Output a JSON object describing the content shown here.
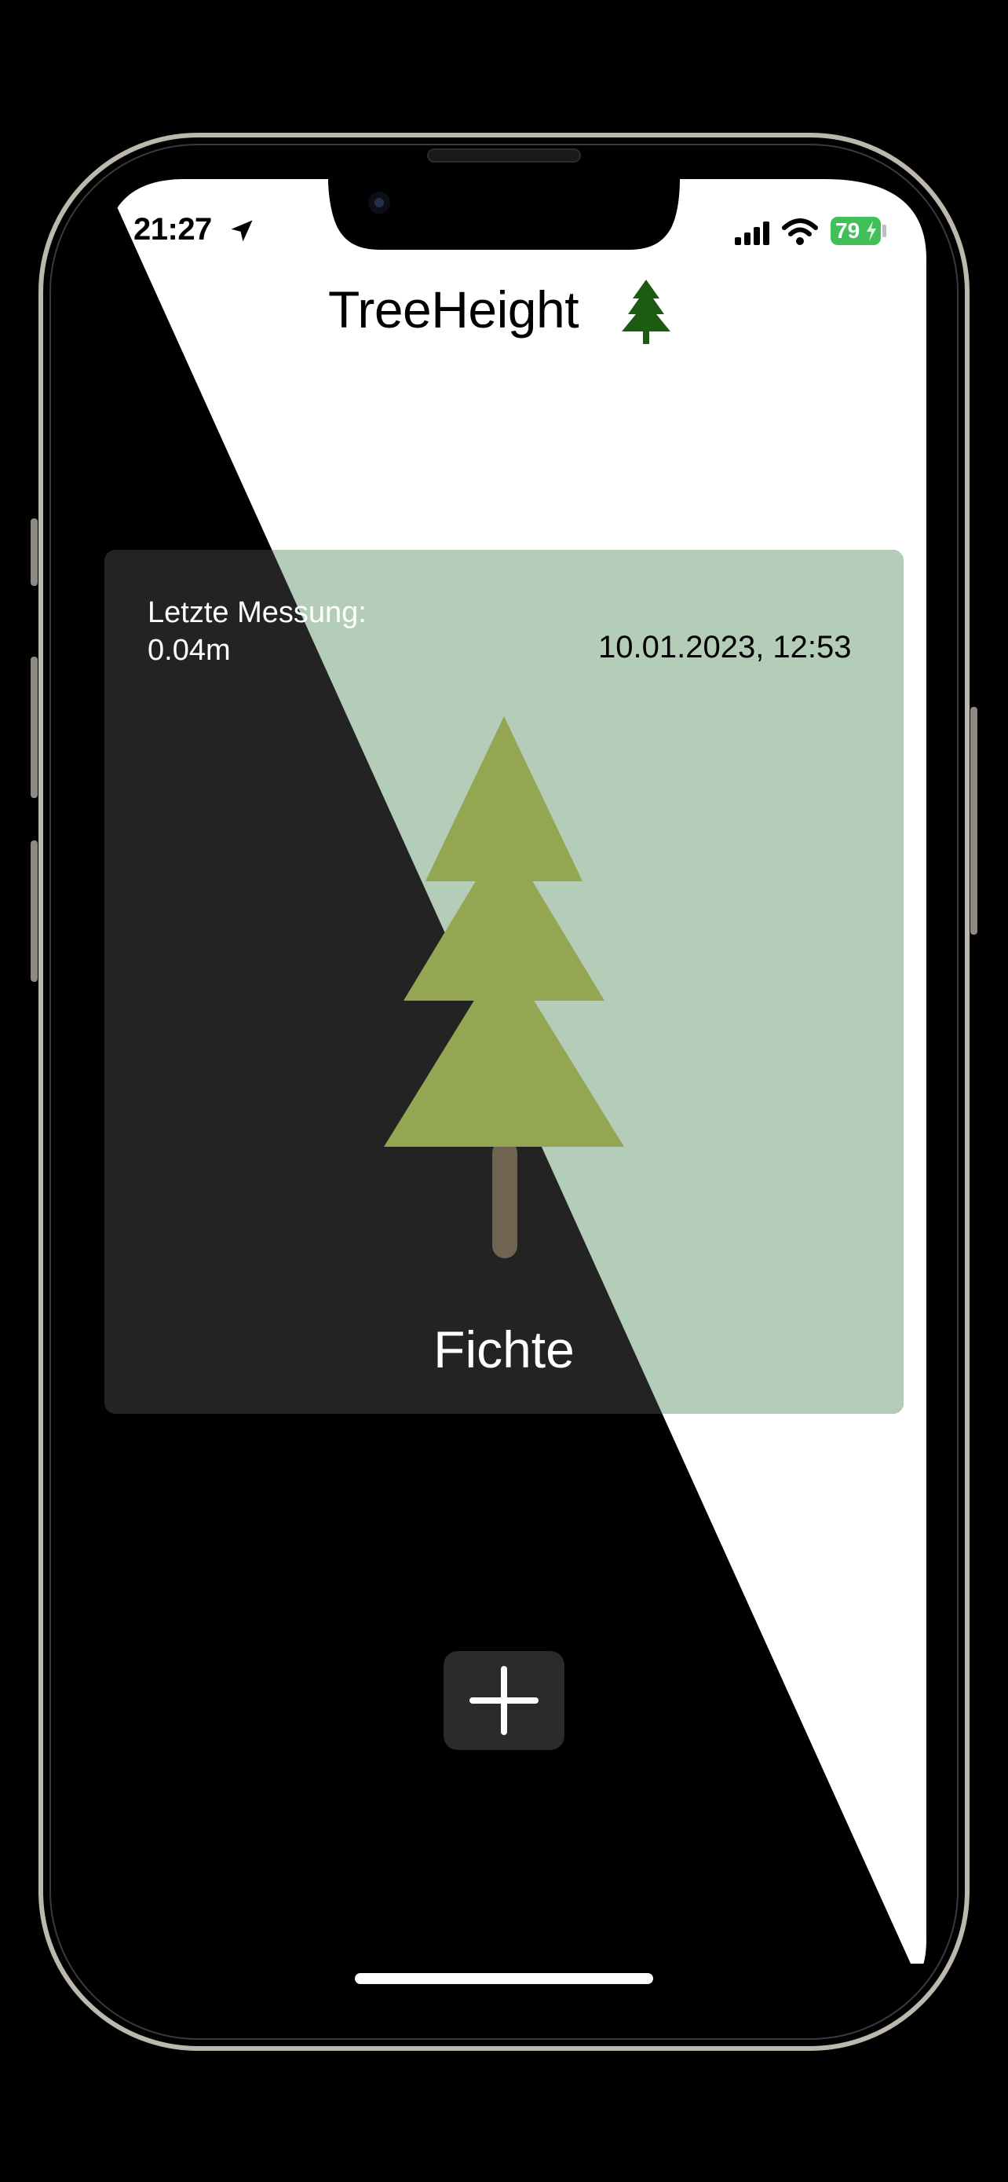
{
  "status_bar": {
    "time": "21:27",
    "battery": "79"
  },
  "header": {
    "title": "TreeHeight"
  },
  "card": {
    "last_measurement_label": "Letzte Messung:",
    "last_measurement_value": "0.04m",
    "timestamp": "10.01.2023, 12:53",
    "tree_name": "Fichte"
  },
  "colors": {
    "frame_bezel": "#b9b5ac",
    "screen_light": "#ffffff",
    "screen_dark": "#000000",
    "card_light": "#b3cdb8",
    "card_dark": "#232323",
    "tree_foliage": "#95a652",
    "tree_trunk": "#6e6450",
    "header_tree_icon": "#1d5b12",
    "battery_green": "#41c05a",
    "add_button_bg": "#2b2b2d"
  },
  "icons": {
    "location": "location-arrow-icon",
    "signal": "cellular-signal-icon",
    "wifi": "wifi-icon",
    "battery": "battery-charging-icon",
    "header_tree": "pine-tree-icon",
    "card_tree": "pine-tree-illustration",
    "add": "plus-icon"
  }
}
